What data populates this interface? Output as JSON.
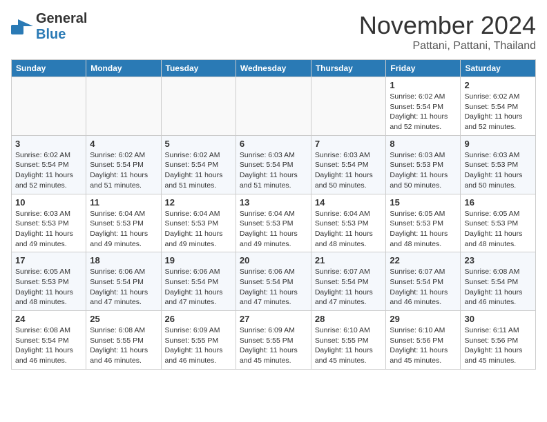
{
  "header": {
    "logo_general": "General",
    "logo_blue": "Blue",
    "month_title": "November 2024",
    "location": "Pattani, Pattani, Thailand"
  },
  "columns": [
    "Sunday",
    "Monday",
    "Tuesday",
    "Wednesday",
    "Thursday",
    "Friday",
    "Saturday"
  ],
  "weeks": [
    [
      {
        "day": "",
        "info": ""
      },
      {
        "day": "",
        "info": ""
      },
      {
        "day": "",
        "info": ""
      },
      {
        "day": "",
        "info": ""
      },
      {
        "day": "",
        "info": ""
      },
      {
        "day": "1",
        "info": "Sunrise: 6:02 AM\nSunset: 5:54 PM\nDaylight: 11 hours\nand 52 minutes."
      },
      {
        "day": "2",
        "info": "Sunrise: 6:02 AM\nSunset: 5:54 PM\nDaylight: 11 hours\nand 52 minutes."
      }
    ],
    [
      {
        "day": "3",
        "info": "Sunrise: 6:02 AM\nSunset: 5:54 PM\nDaylight: 11 hours\nand 52 minutes."
      },
      {
        "day": "4",
        "info": "Sunrise: 6:02 AM\nSunset: 5:54 PM\nDaylight: 11 hours\nand 51 minutes."
      },
      {
        "day": "5",
        "info": "Sunrise: 6:02 AM\nSunset: 5:54 PM\nDaylight: 11 hours\nand 51 minutes."
      },
      {
        "day": "6",
        "info": "Sunrise: 6:03 AM\nSunset: 5:54 PM\nDaylight: 11 hours\nand 51 minutes."
      },
      {
        "day": "7",
        "info": "Sunrise: 6:03 AM\nSunset: 5:54 PM\nDaylight: 11 hours\nand 50 minutes."
      },
      {
        "day": "8",
        "info": "Sunrise: 6:03 AM\nSunset: 5:53 PM\nDaylight: 11 hours\nand 50 minutes."
      },
      {
        "day": "9",
        "info": "Sunrise: 6:03 AM\nSunset: 5:53 PM\nDaylight: 11 hours\nand 50 minutes."
      }
    ],
    [
      {
        "day": "10",
        "info": "Sunrise: 6:03 AM\nSunset: 5:53 PM\nDaylight: 11 hours\nand 49 minutes."
      },
      {
        "day": "11",
        "info": "Sunrise: 6:04 AM\nSunset: 5:53 PM\nDaylight: 11 hours\nand 49 minutes."
      },
      {
        "day": "12",
        "info": "Sunrise: 6:04 AM\nSunset: 5:53 PM\nDaylight: 11 hours\nand 49 minutes."
      },
      {
        "day": "13",
        "info": "Sunrise: 6:04 AM\nSunset: 5:53 PM\nDaylight: 11 hours\nand 49 minutes."
      },
      {
        "day": "14",
        "info": "Sunrise: 6:04 AM\nSunset: 5:53 PM\nDaylight: 11 hours\nand 48 minutes."
      },
      {
        "day": "15",
        "info": "Sunrise: 6:05 AM\nSunset: 5:53 PM\nDaylight: 11 hours\nand 48 minutes."
      },
      {
        "day": "16",
        "info": "Sunrise: 6:05 AM\nSunset: 5:53 PM\nDaylight: 11 hours\nand 48 minutes."
      }
    ],
    [
      {
        "day": "17",
        "info": "Sunrise: 6:05 AM\nSunset: 5:53 PM\nDaylight: 11 hours\nand 48 minutes."
      },
      {
        "day": "18",
        "info": "Sunrise: 6:06 AM\nSunset: 5:54 PM\nDaylight: 11 hours\nand 47 minutes."
      },
      {
        "day": "19",
        "info": "Sunrise: 6:06 AM\nSunset: 5:54 PM\nDaylight: 11 hours\nand 47 minutes."
      },
      {
        "day": "20",
        "info": "Sunrise: 6:06 AM\nSunset: 5:54 PM\nDaylight: 11 hours\nand 47 minutes."
      },
      {
        "day": "21",
        "info": "Sunrise: 6:07 AM\nSunset: 5:54 PM\nDaylight: 11 hours\nand 47 minutes."
      },
      {
        "day": "22",
        "info": "Sunrise: 6:07 AM\nSunset: 5:54 PM\nDaylight: 11 hours\nand 46 minutes."
      },
      {
        "day": "23",
        "info": "Sunrise: 6:08 AM\nSunset: 5:54 PM\nDaylight: 11 hours\nand 46 minutes."
      }
    ],
    [
      {
        "day": "24",
        "info": "Sunrise: 6:08 AM\nSunset: 5:54 PM\nDaylight: 11 hours\nand 46 minutes."
      },
      {
        "day": "25",
        "info": "Sunrise: 6:08 AM\nSunset: 5:55 PM\nDaylight: 11 hours\nand 46 minutes."
      },
      {
        "day": "26",
        "info": "Sunrise: 6:09 AM\nSunset: 5:55 PM\nDaylight: 11 hours\nand 46 minutes."
      },
      {
        "day": "27",
        "info": "Sunrise: 6:09 AM\nSunset: 5:55 PM\nDaylight: 11 hours\nand 45 minutes."
      },
      {
        "day": "28",
        "info": "Sunrise: 6:10 AM\nSunset: 5:55 PM\nDaylight: 11 hours\nand 45 minutes."
      },
      {
        "day": "29",
        "info": "Sunrise: 6:10 AM\nSunset: 5:56 PM\nDaylight: 11 hours\nand 45 minutes."
      },
      {
        "day": "30",
        "info": "Sunrise: 6:11 AM\nSunset: 5:56 PM\nDaylight: 11 hours\nand 45 minutes."
      }
    ]
  ]
}
